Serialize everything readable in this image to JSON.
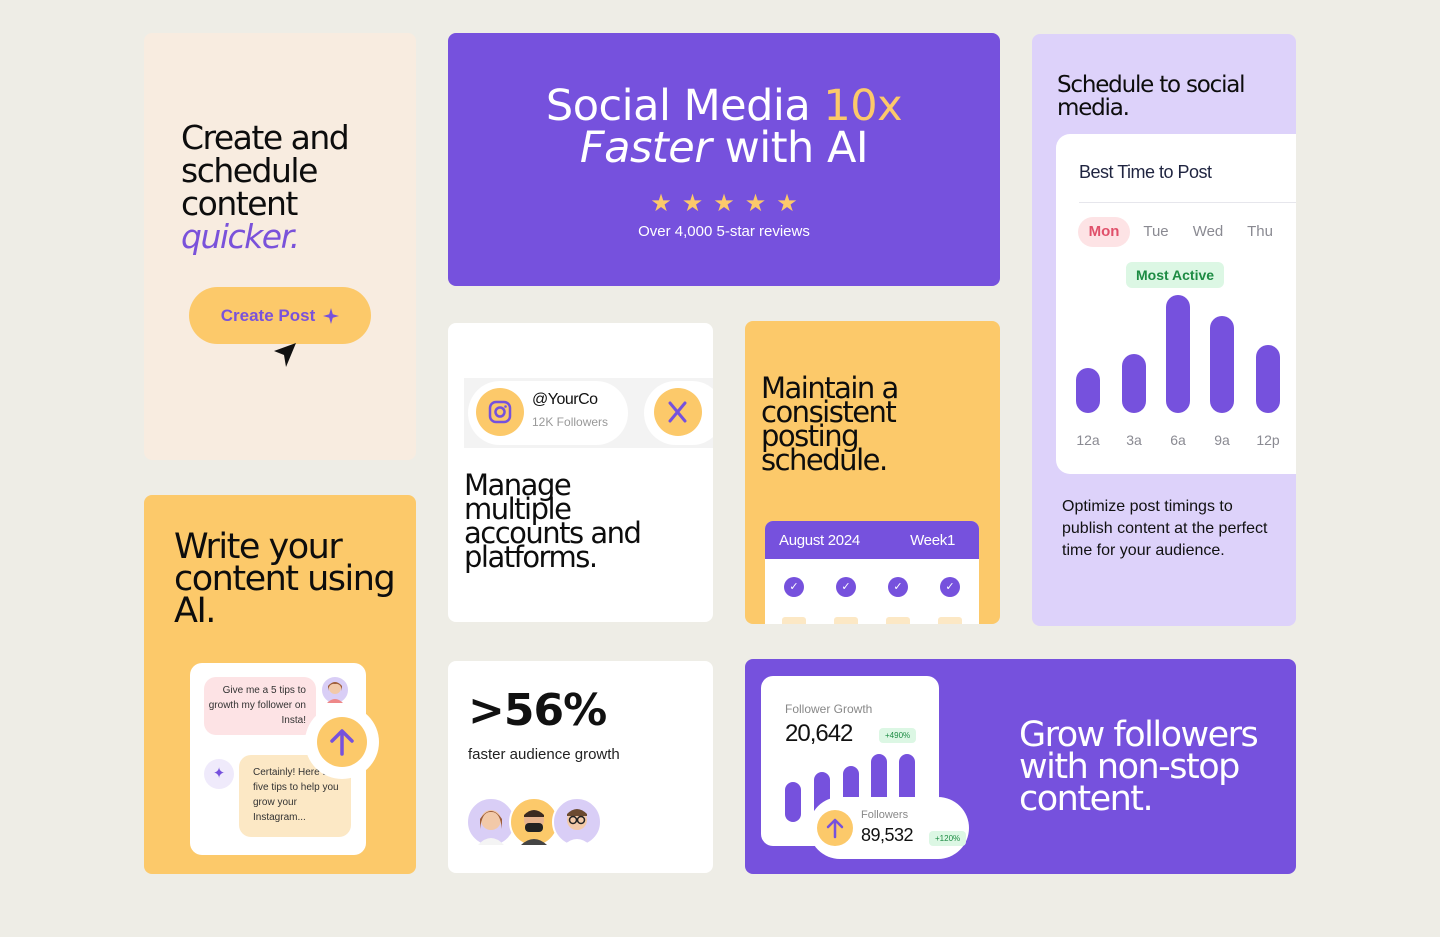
{
  "card_create": {
    "heading_line1": "Create and",
    "heading_line2": "schedule",
    "heading_line3": "content",
    "heading_accent": "quicker.",
    "button_label": "Create Post"
  },
  "hero": {
    "title_part1": "Social Media ",
    "title_highlight": "10x",
    "title_italic": "Faster",
    "title_part2": " with AI",
    "rating_stars": 5,
    "reviews_text": "Over 4,000 5-star reviews"
  },
  "card_schedule": {
    "heading": "Schedule to social media.",
    "panel_title": "Best Time to Post",
    "days": [
      "Mon",
      "Tue",
      "Wed",
      "Thu"
    ],
    "selected_day": "Mon",
    "badge": "Most Active",
    "time_labels": [
      "12a",
      "3a",
      "6a",
      "9a",
      "12p"
    ],
    "activity_levels": [
      0.38,
      0.5,
      1.0,
      0.82,
      0.58
    ],
    "description": "Optimize post timings to publish content at the perfect time for your audience."
  },
  "card_write": {
    "heading": "Write your content using AI.",
    "prompt_text": "Give me a 5 tips to growth my follower on Insta!",
    "reply_text": "Certainly! Here are five tips to help you grow your Instagram..."
  },
  "card_accounts": {
    "handle": "@YourCo",
    "followers": "12K Followers",
    "heading": "Manage multiple accounts and platforms."
  },
  "card_consistent": {
    "heading": "Maintain a consistent posting schedule.",
    "month": "August 2024",
    "week": "Week1"
  },
  "card_growth_stat": {
    "stat": ">56%",
    "caption": "faster audience growth"
  },
  "card_grow": {
    "growth_label": "Follower Growth",
    "growth_value": "20,642",
    "growth_pill": "+490%",
    "followers_label": "Followers",
    "followers_value": "89,532",
    "followers_pill": "+120%",
    "heading": "Grow followers with non-stop content."
  },
  "colors": {
    "purple": "#7651DD",
    "yellow": "#FCC96A",
    "lavender": "#DDD2FA",
    "peach": "#F8ECE0",
    "background": "#EEEDE6"
  }
}
